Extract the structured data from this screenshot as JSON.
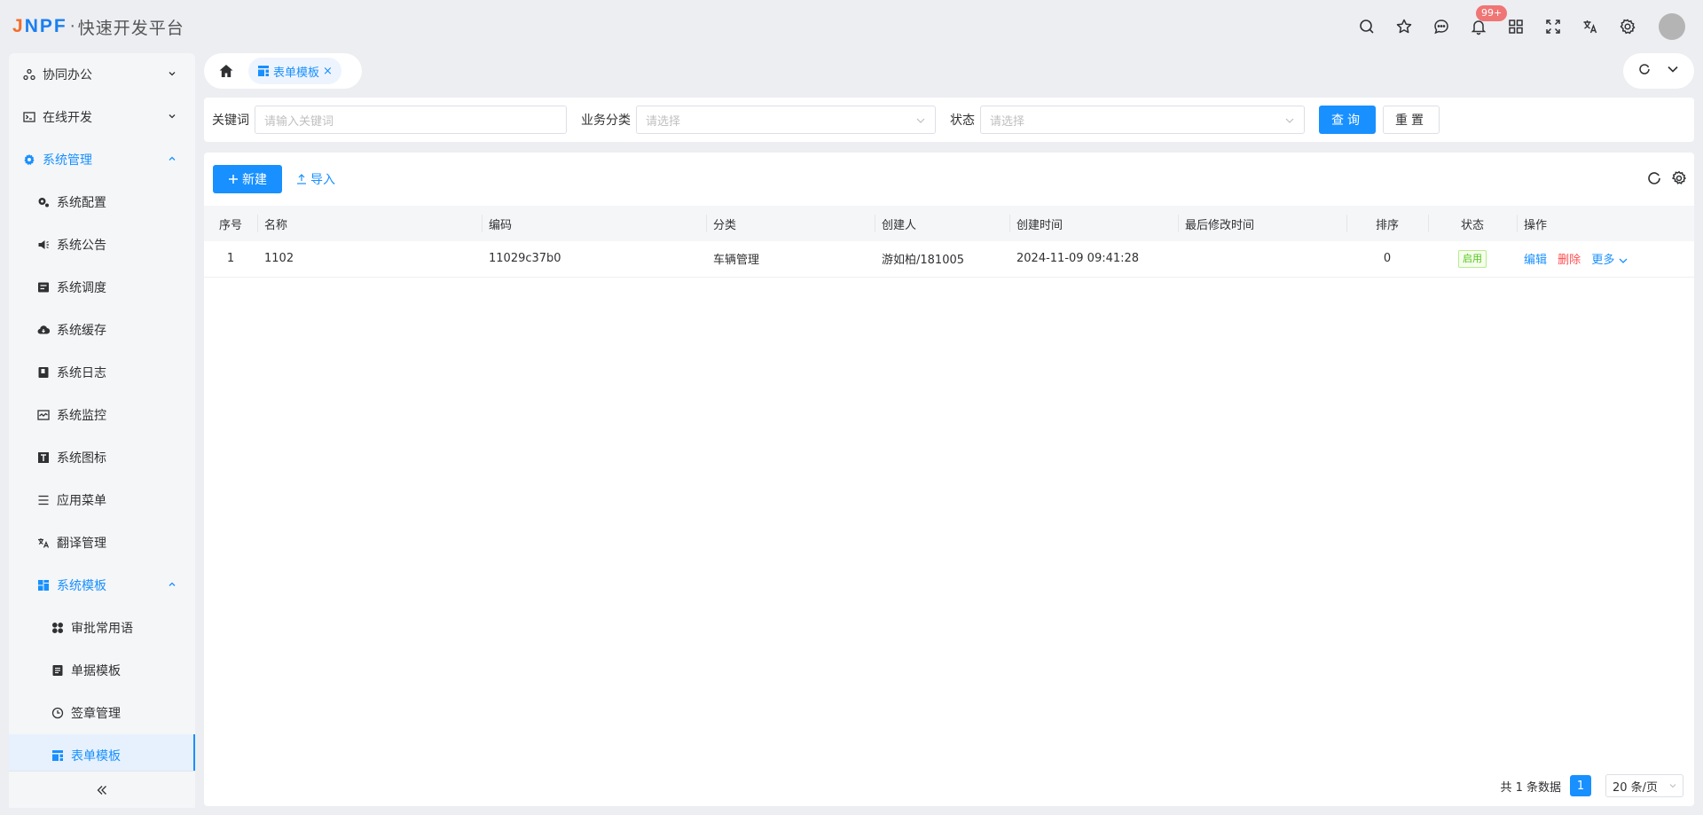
{
  "app": {
    "brand_j": "J",
    "brand_rest": "NPF",
    "separator": "·",
    "title": "快速开发平台"
  },
  "header": {
    "notification_badge": "99+",
    "icons": [
      "search-icon",
      "star-icon",
      "message-icon",
      "bell-icon",
      "apps-icon",
      "fullscreen-icon",
      "translate-icon",
      "settings-icon",
      "avatar"
    ]
  },
  "sidebar": {
    "items": [
      {
        "label": "协同办公",
        "icon": "cluster-icon",
        "level": 1,
        "state": "collapsed"
      },
      {
        "label": "在线开发",
        "icon": "terminal-icon",
        "level": 1,
        "state": "collapsed"
      },
      {
        "label": "系统管理",
        "icon": "gear-icon",
        "level": 1,
        "state": "open"
      },
      {
        "label": "系统配置",
        "icon": "config-icon",
        "level": 2
      },
      {
        "label": "系统公告",
        "icon": "announce-icon",
        "level": 2
      },
      {
        "label": "系统调度",
        "icon": "schedule-icon",
        "level": 2
      },
      {
        "label": "系统缓存",
        "icon": "cloud-icon",
        "level": 2
      },
      {
        "label": "系统日志",
        "icon": "log-icon",
        "level": 2
      },
      {
        "label": "系统监控",
        "icon": "monitor-icon",
        "level": 2
      },
      {
        "label": "系统图标",
        "icon": "font-icon",
        "level": 2
      },
      {
        "label": "应用菜单",
        "icon": "menu-icon",
        "level": 2
      },
      {
        "label": "翻译管理",
        "icon": "translate-icon",
        "level": 2
      },
      {
        "label": "系统模板",
        "icon": "template-icon",
        "level": 2,
        "state": "open"
      },
      {
        "label": "审批常用语",
        "icon": "phrases-icon",
        "level": 3
      },
      {
        "label": "单据模板",
        "icon": "document-icon",
        "level": 3
      },
      {
        "label": "签章管理",
        "icon": "seal-icon",
        "level": 3
      },
      {
        "label": "表单模板",
        "icon": "form-template-icon",
        "level": 3,
        "state": "active"
      }
    ]
  },
  "tabs": [
    {
      "label": "表单模板",
      "close": "×"
    }
  ],
  "search": {
    "keyword_label": "关键词",
    "keyword_placeholder": "请输入关键词",
    "category_label": "业务分类",
    "category_placeholder": "请选择",
    "status_label": "状态",
    "status_placeholder": "请选择",
    "query_button": "查询",
    "reset_button": "重置"
  },
  "toolbar": {
    "new_button": "新建",
    "import_button": "导入"
  },
  "table": {
    "columns": [
      "序号",
      "名称",
      "编码",
      "分类",
      "创建人",
      "创建时间",
      "最后修改时间",
      "排序",
      "状态",
      "操作"
    ],
    "rows": [
      {
        "index": "1",
        "name": "1102",
        "code": "11029c37b0",
        "category": "车辆管理",
        "creator": "游如柏/181005",
        "created_at": "2024-11-09 09:41:28",
        "modified_at": "",
        "sort": "0",
        "status": "启用",
        "edit": "编辑",
        "delete": "删除",
        "more": "更多"
      }
    ]
  },
  "pagination": {
    "total_text": "共 1 条数据",
    "current_page": "1",
    "page_size": "20 条/页"
  },
  "colors": {
    "primary": "#1890ff",
    "danger": "#ff4d4f",
    "success": "#52c41a",
    "badge": "#f07575"
  }
}
